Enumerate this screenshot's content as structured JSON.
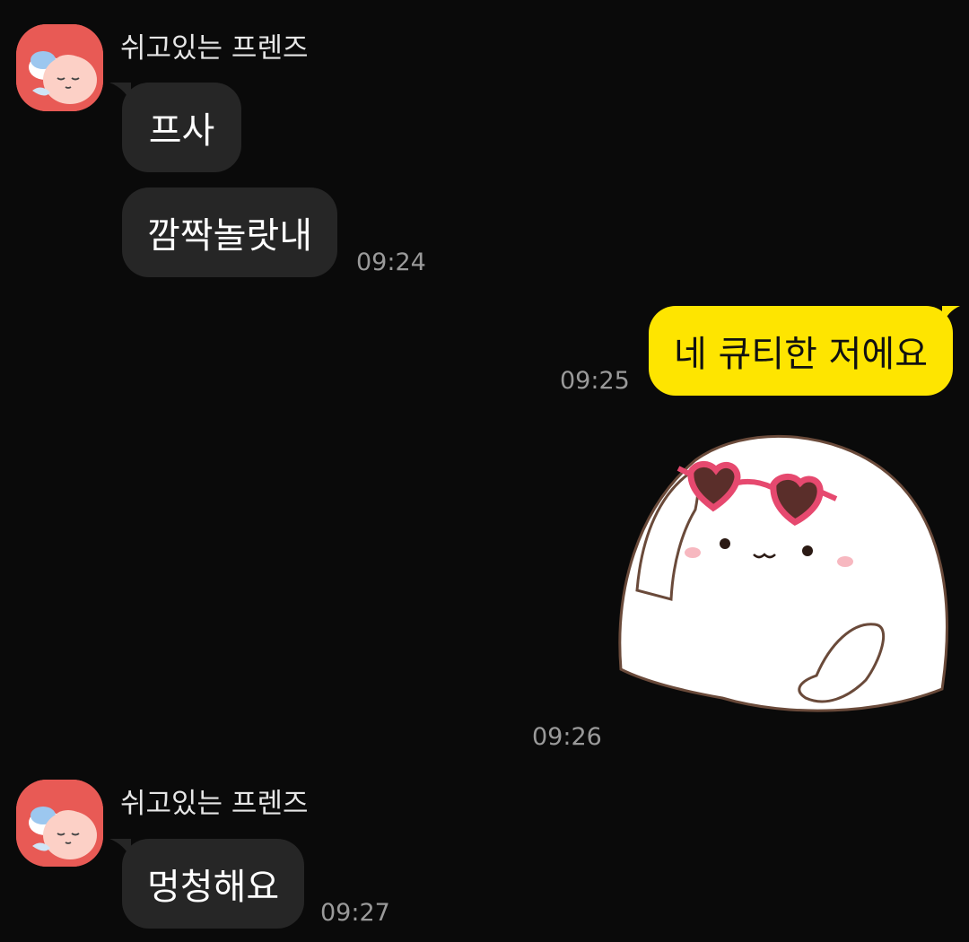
{
  "colors": {
    "background": "#0a0a0a",
    "incoming_bubble": "#262626",
    "outgoing_bubble": "#fee500",
    "avatar_bg": "#e85a55",
    "timestamp": "#9a9a9a"
  },
  "groups": [
    {
      "sender": "쉬고있는 프렌즈",
      "avatar_icon": "sleeping-friends-avatar-icon",
      "messages": [
        {
          "text": "프사"
        },
        {
          "text": "깜짝놀랏내",
          "time": "09:24"
        }
      ]
    },
    {
      "sender": "쉬고있는 프렌즈",
      "avatar_icon": "sleeping-friends-avatar-icon",
      "messages": [
        {
          "text": "멍청해요",
          "time": "09:27"
        }
      ]
    }
  ],
  "outgoing": [
    {
      "text": "네 큐티한 저에요",
      "time": "09:25"
    },
    {
      "sticker": "white-blob-heart-sunglasses-sticker",
      "time": "09:26"
    }
  ]
}
